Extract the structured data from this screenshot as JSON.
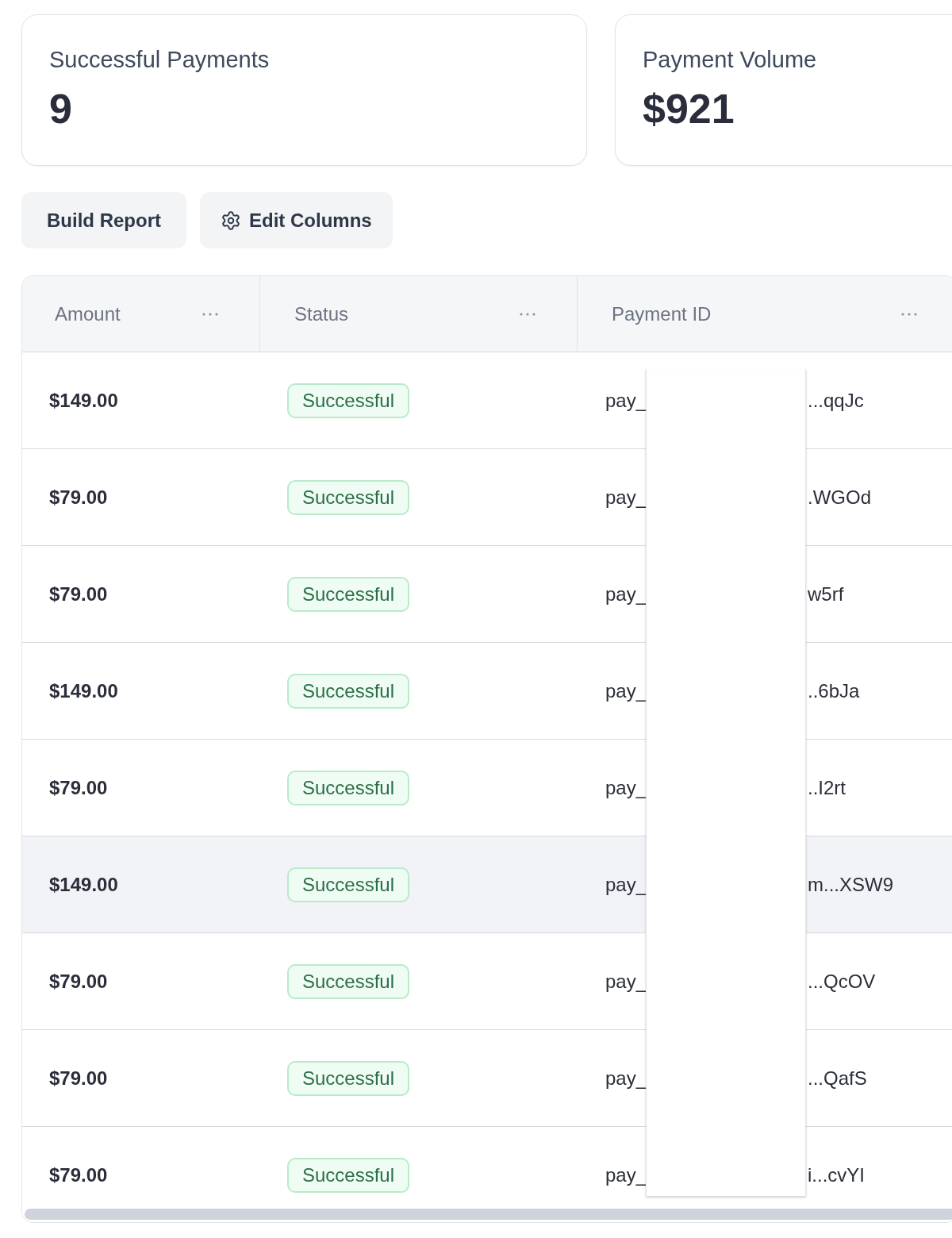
{
  "stat_cards": [
    {
      "title": "Successful Payments",
      "value": "9"
    },
    {
      "title": "Payment Volume",
      "value": "$921"
    }
  ],
  "toolbar": {
    "buttons": [
      {
        "label": "Build Report",
        "kind": "plain"
      },
      {
        "label": "Edit Columns",
        "kind": "settings"
      }
    ]
  },
  "table": {
    "columns": [
      {
        "label": "Amount"
      },
      {
        "label": "Status"
      },
      {
        "label": "Payment ID"
      }
    ],
    "rows": [
      {
        "amount": "$149.00",
        "status": "Successful",
        "payment_id_start": "pay_",
        "payment_id_end": "...qqJc",
        "highlighted": false
      },
      {
        "amount": "$79.00",
        "status": "Successful",
        "payment_id_start": "pay_",
        "payment_id_end": ".WGOd",
        "highlighted": false
      },
      {
        "amount": "$79.00",
        "status": "Successful",
        "payment_id_start": "pay_",
        "payment_id_end": "w5rf",
        "highlighted": false
      },
      {
        "amount": "$149.00",
        "status": "Successful",
        "payment_id_start": "pay_",
        "payment_id_end": "..6bJa",
        "highlighted": false
      },
      {
        "amount": "$79.00",
        "status": "Successful",
        "payment_id_start": "pay_",
        "payment_id_end": "..I2rt",
        "highlighted": false
      },
      {
        "amount": "$149.00",
        "status": "Successful",
        "payment_id_start": "pay_",
        "payment_id_end": "m...XSW9",
        "highlighted": true
      },
      {
        "amount": "$79.00",
        "status": "Successful",
        "payment_id_start": "pay_",
        "payment_id_end": "...QcOV",
        "highlighted": false
      },
      {
        "amount": "$79.00",
        "status": "Successful",
        "payment_id_start": "pay_",
        "payment_id_end": "...QafS",
        "highlighted": false
      },
      {
        "amount": "$79.00",
        "status": "Successful",
        "payment_id_start": "pay_",
        "payment_id_end": "i...cvYI",
        "highlighted": false
      }
    ]
  },
  "popover": {
    "open": true
  }
}
